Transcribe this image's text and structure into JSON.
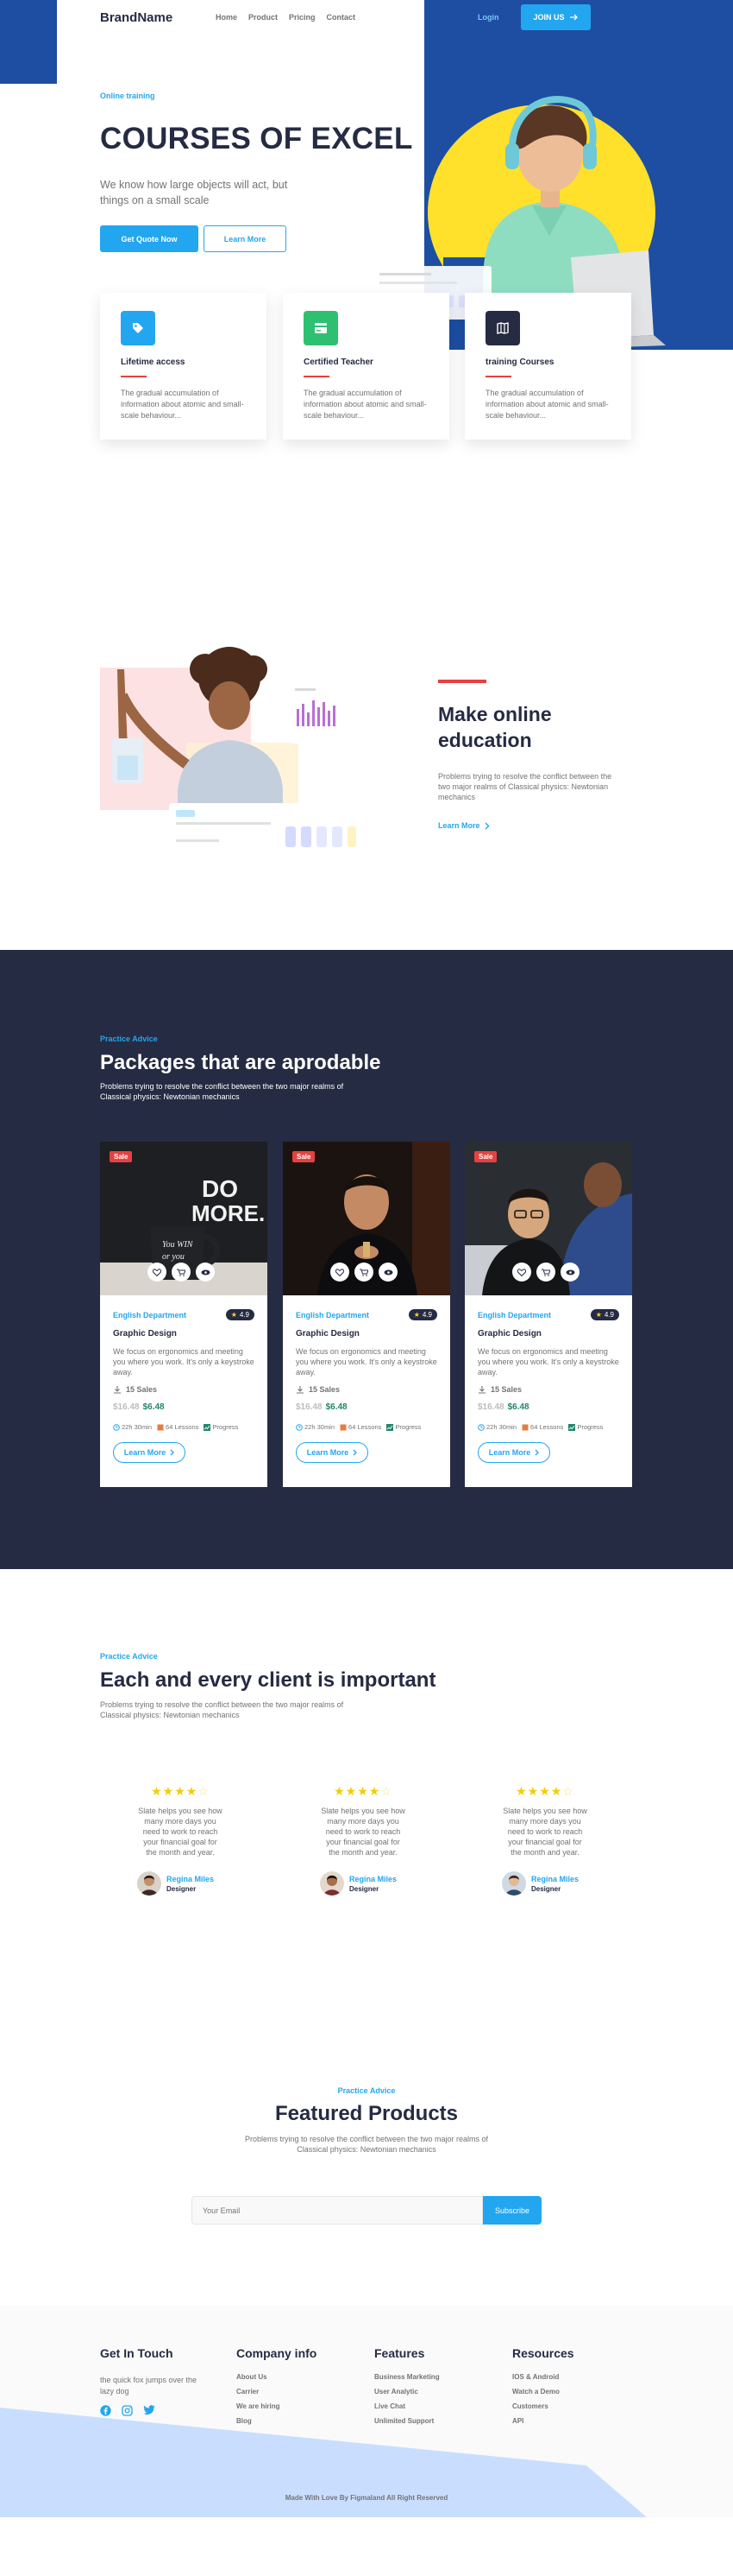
{
  "header": {
    "brand": "BrandName",
    "nav": [
      "Home",
      "Product",
      "Pricing",
      "Contact"
    ],
    "login": "Login",
    "join": "JOIN US"
  },
  "hero": {
    "eyebrow": "Online training",
    "title": "COURSES OF EXCEL",
    "subtitle": "We know how large objects will act, but things on a small scale",
    "primary_button": "Get Quote Now",
    "secondary_button": "Learn More"
  },
  "features": [
    {
      "title": "Lifetime access",
      "text": "The gradual accumulation of information about atomic and small-scale behaviour...",
      "icon": "tag-icon",
      "color": "#23A6F0"
    },
    {
      "title": "Certified Teacher",
      "text": "The gradual accumulation of information about atomic and small-scale behaviour...",
      "icon": "certificate-icon",
      "color": "#2DC071"
    },
    {
      "title": "training Courses",
      "text": "The gradual accumulation of information about atomic and small-scale behaviour...",
      "icon": "book-icon",
      "color": "#252B42"
    }
  ],
  "education": {
    "title": "Make online education",
    "text": "Problems trying to resolve the conflict between the two major realms of Classical physics: Newtonian mechanics",
    "link": "Learn More"
  },
  "packages": {
    "eyebrow": "Practice Advice",
    "title": "Packages that are aprodable",
    "subtitle": "Problems trying to resolve the conflict between the two major realms of Classical physics: Newtonian mechanics",
    "cards": [
      {
        "badge": "Sale",
        "department": "English Department",
        "rating": "4.9",
        "name": "Graphic Design",
        "description": "We focus on ergonomics and meeting you where you work. It's only a keystroke away.",
        "sales": "15 Sales",
        "old_price": "$16.48",
        "new_price": "$6.48",
        "duration": "22h 30min",
        "lessons": "64 Lessons",
        "progress": "Progress",
        "button": "Learn More"
      },
      {
        "badge": "Sale",
        "department": "English Department",
        "rating": "4.9",
        "name": "Graphic Design",
        "description": "We focus on ergonomics and meeting you where you work. It's only a keystroke away.",
        "sales": "15 Sales",
        "old_price": "$16.48",
        "new_price": "$6.48",
        "duration": "22h 30min",
        "lessons": "64 Lessons",
        "progress": "Progress",
        "button": "Learn More"
      },
      {
        "badge": "Sale",
        "department": "English Department",
        "rating": "4.9",
        "name": "Graphic Design",
        "description": "We focus on ergonomics and meeting you where you work. It's only a keystroke away.",
        "sales": "15 Sales",
        "old_price": "$16.48",
        "new_price": "$6.48",
        "duration": "22h 30min",
        "lessons": "64 Lessons",
        "progress": "Progress",
        "button": "Learn More"
      }
    ]
  },
  "testimonials": {
    "eyebrow": "Practice Advice",
    "title": "Each and every client is important",
    "subtitle": "Problems trying to resolve the conflict between the two major realms of Classical physics: Newtonian mechanics",
    "items": [
      {
        "rating": 4,
        "text": "Slate helps you see how many more days you need to work to reach your financial goal for the month and year.",
        "name": "Regina Miles",
        "role": "Designer"
      },
      {
        "rating": 4,
        "text": "Slate helps you see how many more days you need to work to reach your financial goal for the month and year.",
        "name": "Regina Miles",
        "role": "Designer"
      },
      {
        "rating": 4,
        "text": "Slate helps you see how many more days you need to work to reach your financial goal for the month and year.",
        "name": "Regina Miles",
        "role": "Designer"
      }
    ]
  },
  "featured": {
    "eyebrow": "Practice Advice",
    "title": "Featured Products",
    "subtitle": "Problems trying to resolve the conflict between the two major realms of Classical physics: Newtonian mechanics",
    "email_placeholder": "Your Email",
    "subscribe": "Subscribe"
  },
  "footer": {
    "get_in_touch": {
      "title": "Get In Touch",
      "text": "the quick fox jumps over the lazy dog"
    },
    "columns": [
      {
        "title": "Company info",
        "items": [
          "About Us",
          "Carrier",
          "We are hiring",
          "Blog"
        ]
      },
      {
        "title": "Features",
        "items": [
          "Business Marketing",
          "User Analytic",
          "Live Chat",
          "Unlimited Support"
        ]
      },
      {
        "title": "Resources",
        "items": [
          "IOS & Android",
          "Watch a Demo",
          "Customers",
          "API"
        ]
      }
    ],
    "copyright": "Made With Love By Figmaland All Right Reserved"
  },
  "colors": {
    "primary": "#23A6F0",
    "hero_blue": "#1D4EA2",
    "dark": "#252B42",
    "danger": "#E74040",
    "success": "#23856D",
    "star": "#F3CD03"
  }
}
